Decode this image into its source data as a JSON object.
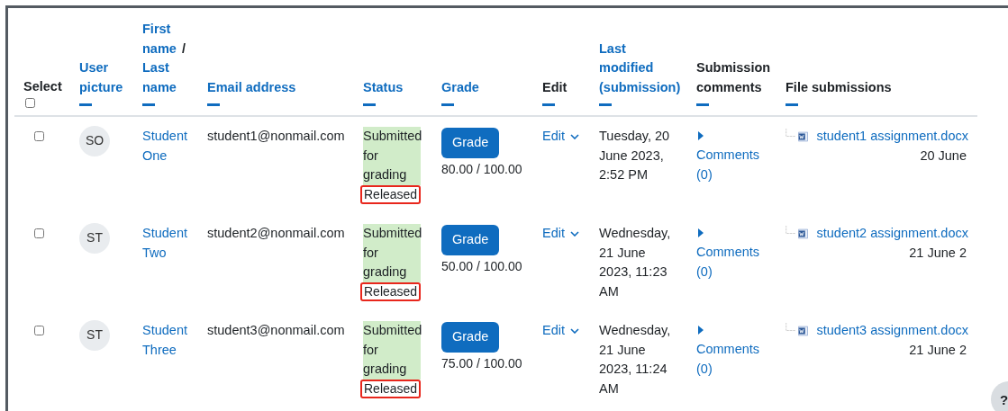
{
  "columns": [
    {
      "kind": "select",
      "label": "Select",
      "sortable": false
    },
    {
      "kind": "link",
      "label": "User picture",
      "sortable": true
    },
    {
      "kind": "pair",
      "links": [
        "First name",
        "Last name"
      ],
      "separator": "/",
      "sortable": true
    },
    {
      "kind": "link",
      "label": "Email address",
      "sortable": true
    },
    {
      "kind": "link",
      "label": "Status",
      "sortable": true
    },
    {
      "kind": "link",
      "label": "Grade",
      "sortable": true
    },
    {
      "kind": "plain",
      "label": "Edit",
      "sortable": true
    },
    {
      "kind": "link",
      "label": "Last modified (submission)",
      "sortable": true
    },
    {
      "kind": "plain",
      "label": "Submission comments",
      "sortable": true
    },
    {
      "kind": "plain",
      "label": "File submissions",
      "sortable": true
    }
  ],
  "select_all": {
    "checked": false
  },
  "rows": [
    {
      "checked": false,
      "initials": "SO",
      "name": "Student One",
      "email": "student1@nonmail.com",
      "status": "Submitted for grading",
      "release": "Released",
      "release_highlighted": true,
      "grade_button": "Grade",
      "grade": "80.00 / 100.00",
      "edit": "Edit",
      "modified": "Tuesday, 20 June 2023, 2:52 PM",
      "comments": "Comments (0)",
      "file": "student1 assignment.docx",
      "file_date": "20 June"
    },
    {
      "checked": false,
      "initials": "ST",
      "name": "Student Two",
      "email": "student2@nonmail.com",
      "status": "Submitted for grading",
      "release": "Released",
      "release_highlighted": true,
      "grade_button": "Grade",
      "grade": "50.00 / 100.00",
      "edit": "Edit",
      "modified": "Wednesday, 21 June 2023, 11:23 AM",
      "comments": "Comments (0)",
      "file": "student2 assignment.docx",
      "file_date": "21 June 2"
    },
    {
      "checked": false,
      "initials": "ST",
      "name": "Student Three",
      "email": "student3@nonmail.com",
      "status": "Submitted for grading",
      "release": "Released",
      "release_highlighted": true,
      "grade_button": "Grade",
      "grade": "75.00 / 100.00",
      "edit": "Edit",
      "modified": "Wednesday, 21 June 2023, 11:24 AM",
      "comments": "Comments (0)",
      "file": "student3 assignment.docx",
      "file_date": "21 June 2"
    }
  ],
  "help_button": "?"
}
